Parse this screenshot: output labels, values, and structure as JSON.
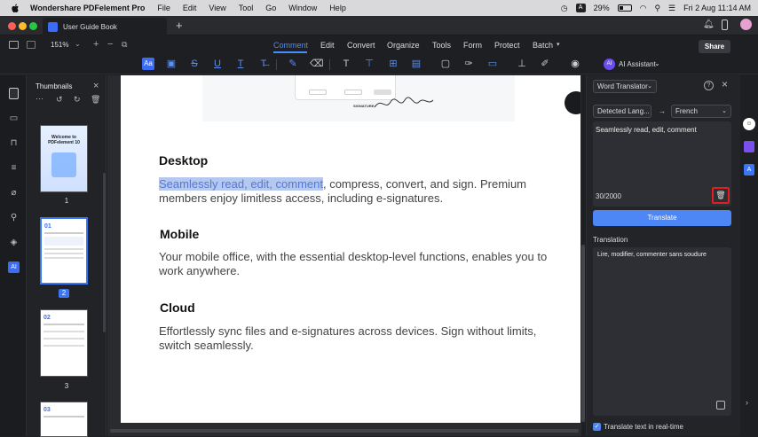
{
  "menubar": {
    "app_name": "Wondershare PDFelement Pro",
    "items": [
      "File",
      "Edit",
      "View",
      "Tool",
      "Go",
      "Window",
      "Help"
    ],
    "battery": "29%",
    "datetime": "Fri 2 Aug  11:14 AM",
    "input_badge": "A"
  },
  "tab": {
    "title": "User Guide Book",
    "add": "+"
  },
  "toolbar": {
    "zoom": "151%",
    "tabs": [
      "Comment",
      "Edit",
      "Convert",
      "Organize",
      "Tools",
      "Form",
      "Protect",
      "Batch"
    ],
    "active_tab": "Comment",
    "share_label": "Share",
    "ai_assistant_label": "AI Assistant",
    "ai_badge": "AI"
  },
  "thumbnails": {
    "title": "Thumbnails",
    "pages": [
      {
        "num": "1",
        "title": "Welcome to PDFelement 10"
      },
      {
        "num": "2",
        "title": "01"
      },
      {
        "num": "3",
        "title": "02"
      },
      {
        "num": "",
        "title": "03"
      }
    ]
  },
  "document": {
    "sections": [
      {
        "heading": "Desktop",
        "highlight": "Seamlessly read, edit, comment",
        "body": ", compress, convert, and sign. Premium members enjoy limitless access, including e-signatures."
      },
      {
        "heading": "Mobile",
        "highlight": "",
        "body": "Your mobile office, with the essential desktop-level functions, enables you to work anywhere."
      },
      {
        "heading": "Cloud",
        "highlight": "",
        "body": "Effortlessly sync files and e-signatures across devices. Sign without limits, switch seamlessly."
      }
    ],
    "signature_label": "SIGNATURE:"
  },
  "translator": {
    "mode": "Word Translator",
    "source_lang": "Detected Lang...",
    "arrow": "→",
    "target_lang": "French",
    "input_text": "Seamlessly read, edit, comment",
    "char_count": "30/2000",
    "translate_button": "Translate",
    "translation_label": "Translation",
    "translation_text": "Lire, modifier, commenter sans soudure",
    "realtime_label": "Translate text in real-time",
    "realtime_checked": true
  }
}
